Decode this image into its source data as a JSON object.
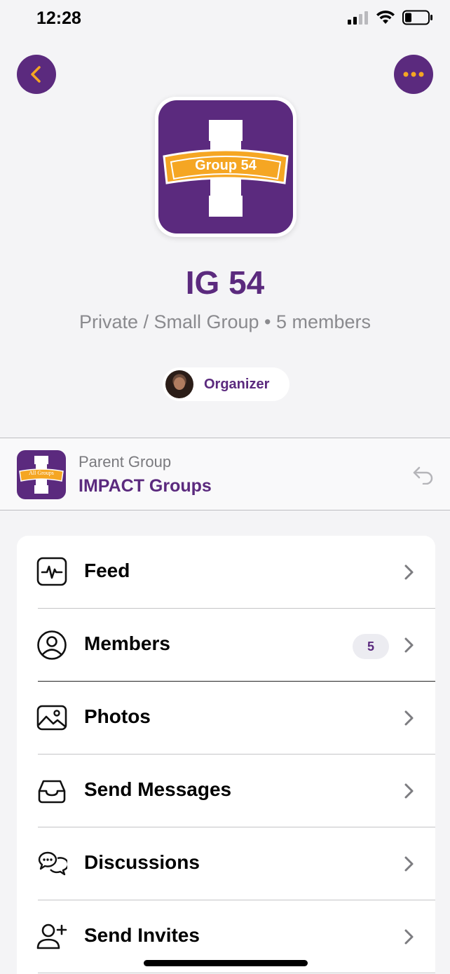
{
  "status_bar": {
    "time": "12:28"
  },
  "group": {
    "banner_text": "Group 54",
    "title": "IG 54",
    "subtitle": "Private / Small Group • 5 members",
    "organizer_label": "Organizer"
  },
  "parent": {
    "banner_text": "All Groups",
    "caption": "Parent Group",
    "name": "IMPACT Groups"
  },
  "menu": {
    "items": [
      {
        "label": "Feed",
        "icon": "activity-icon"
      },
      {
        "label": "Members",
        "icon": "user-circle-icon",
        "badge": "5"
      },
      {
        "label": "Photos",
        "icon": "image-icon"
      },
      {
        "label": "Send Messages",
        "icon": "inbox-icon"
      },
      {
        "label": "Discussions",
        "icon": "chat-bubbles-icon"
      },
      {
        "label": "Send Invites",
        "icon": "user-plus-icon"
      }
    ]
  },
  "colors": {
    "brand_purple": "#5b2a7e",
    "accent_orange": "#f5a623",
    "background": "#f4f4f6"
  }
}
